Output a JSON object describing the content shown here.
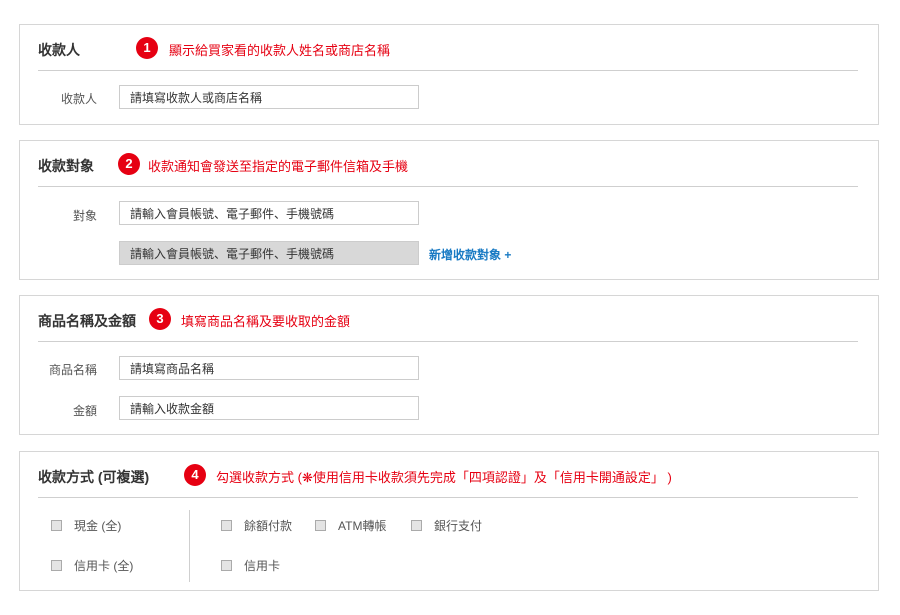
{
  "sections": {
    "payee": {
      "title": "收款人",
      "badge": "1",
      "note": "顯示給買家看的收款人姓名或商店名稱",
      "label": "收款人",
      "input_value": "請填寫收款人或商店名稱"
    },
    "target": {
      "title": "收款對象",
      "badge": "2",
      "note": "收款通知會發送至指定的電子郵件信箱及手機",
      "label": "對象",
      "input_value": "請輸入會員帳號、電子郵件、手機號碼",
      "disabled_value": "請輸入會員帳號、電子郵件、手機號碼",
      "add_link": "新增收款對象 +"
    },
    "product": {
      "title": "商品名稱及金額",
      "badge": "3",
      "note": "填寫商品名稱及要收取的金額",
      "name_label": "商品名稱",
      "name_value": "請填寫商品名稱",
      "amount_label": "金額",
      "amount_value": "請輸入收款金額"
    },
    "payment": {
      "title": "收款方式 (可複選)",
      "badge": "4",
      "note": "勾選收款方式 (❋使用信用卡收款須先完成「四項認證」及「信用卡開通設定」 )",
      "options_left": [
        "現金 (全)",
        "信用卡 (全)"
      ],
      "options_right_row1": [
        "餘額付款",
        "ATM轉帳",
        "銀行支付"
      ],
      "options_right_row2": [
        "信用卡"
      ]
    }
  },
  "colors": {
    "badge": "#e60012",
    "note": "#e60012",
    "link": "#1a7bc4",
    "border": "#d6d6d6"
  }
}
